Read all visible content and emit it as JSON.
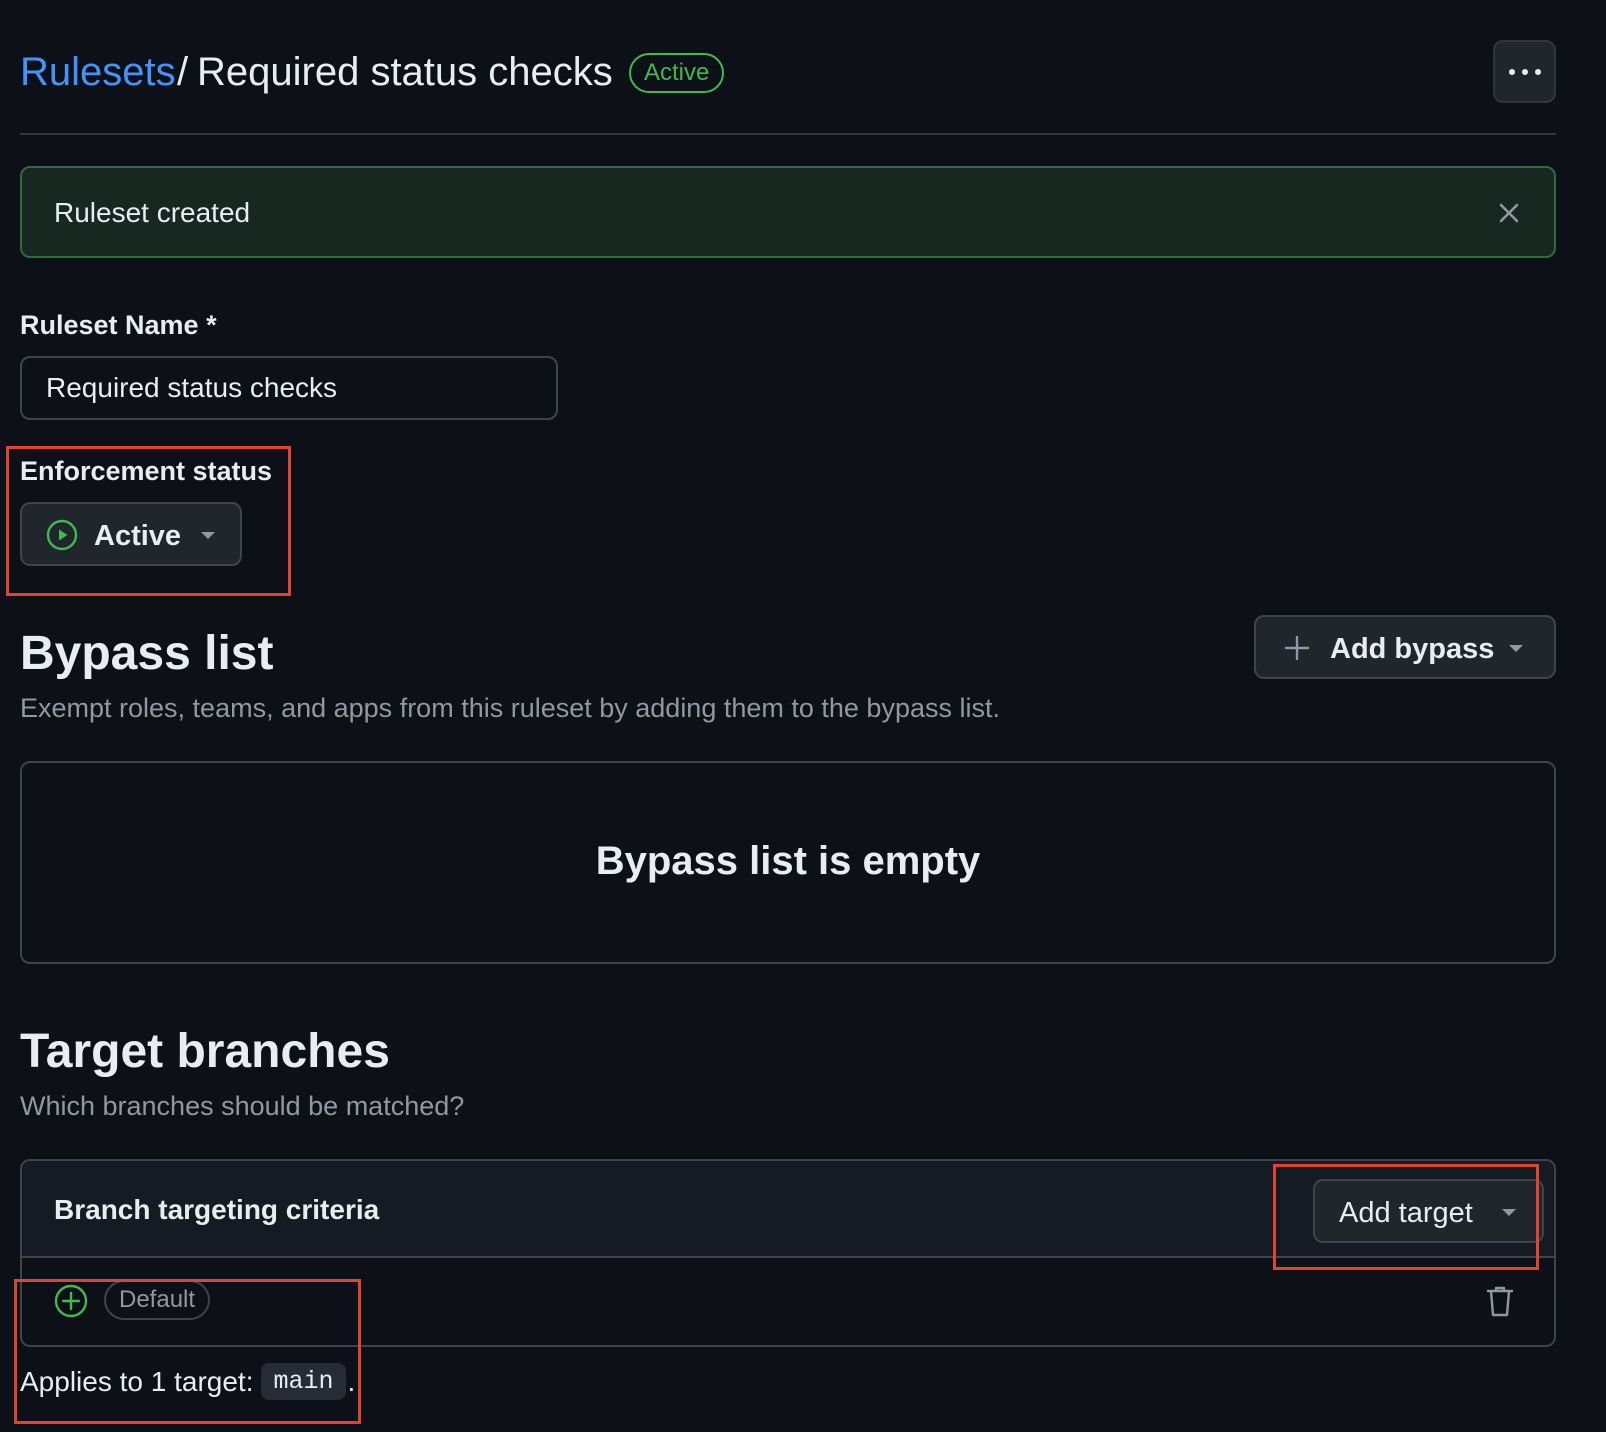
{
  "header": {
    "breadcrumb_link": "Rulesets",
    "separator": "/",
    "title": "Required status checks",
    "status_badge": "Active",
    "more_icon": "kebab-horizontal-icon"
  },
  "flash": {
    "message": "Ruleset created",
    "close_icon": "x-icon"
  },
  "ruleset_name": {
    "label": "Ruleset Name *",
    "value": "Required status checks"
  },
  "enforcement": {
    "label": "Enforcement status",
    "selected": "Active",
    "icon": "play-circle-icon"
  },
  "bypass": {
    "title": "Bypass list",
    "description": "Exempt roles, teams, and apps from this ruleset by adding them to the bypass list.",
    "add_button": "Add bypass",
    "empty_message": "Bypass list is empty"
  },
  "target_branches": {
    "title": "Target branches",
    "description": "Which branches should be matched?",
    "criteria_label": "Branch targeting criteria",
    "add_button": "Add target",
    "rows": [
      {
        "badge": "Default",
        "icon": "plus-circle-icon"
      }
    ],
    "applies_text": "Applies to 1 target:",
    "applies_code": "main",
    "applies_suffix": "."
  },
  "colors": {
    "accent_link": "#4493f8",
    "success": "#3fb950",
    "background": "#0d1117",
    "annotation": "#e0442f"
  }
}
